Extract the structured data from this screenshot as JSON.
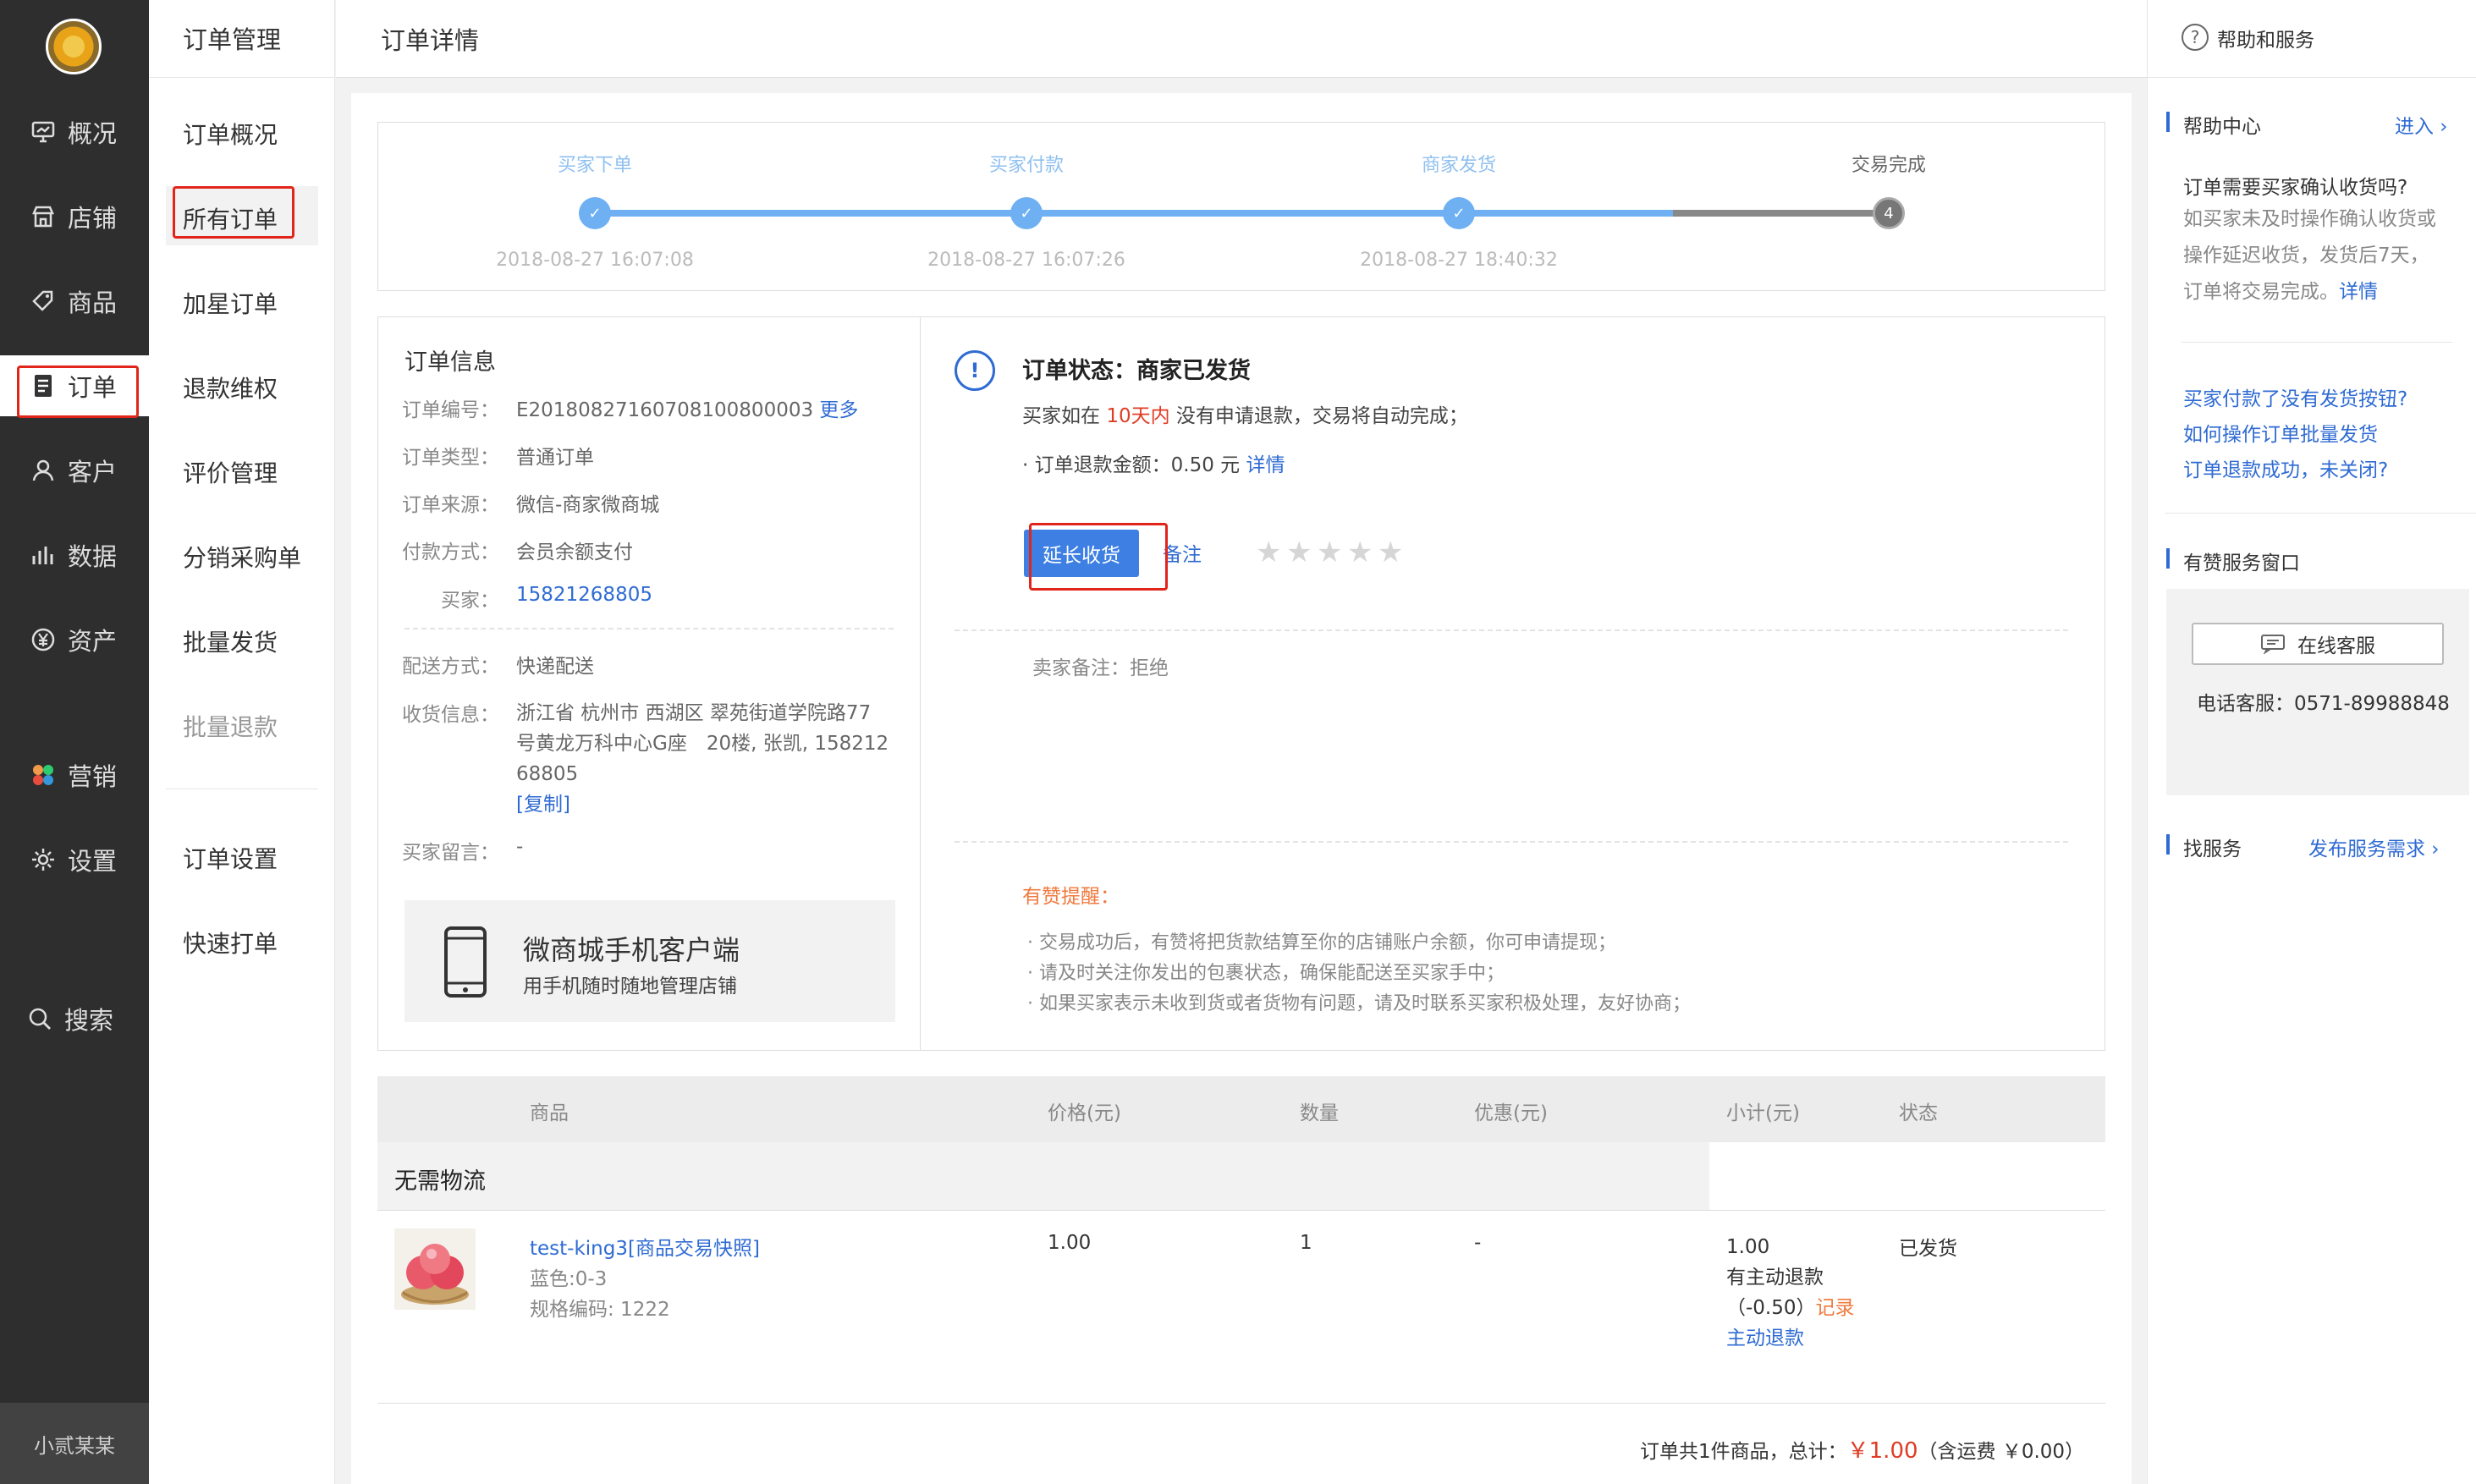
{
  "primary_nav": {
    "items": [
      {
        "label": "概况",
        "icon": "overview-icon"
      },
      {
        "label": "店铺",
        "icon": "store-icon"
      },
      {
        "label": "商品",
        "icon": "tag-icon"
      },
      {
        "label": "订单",
        "icon": "order-icon",
        "active": true
      },
      {
        "label": "客户",
        "icon": "user-icon"
      },
      {
        "label": "数据",
        "icon": "bar-chart-icon"
      },
      {
        "label": "资产",
        "icon": "yen-icon"
      },
      {
        "label": "营销",
        "icon": "apps-icon"
      },
      {
        "label": "设置",
        "icon": "gear-icon"
      },
      {
        "label": "搜索",
        "icon": "search-icon"
      }
    ],
    "username": "小贰某某"
  },
  "secondary_nav": {
    "title": "订单管理",
    "items": [
      "订单概况",
      "所有订单",
      "加星订单",
      "退款维权",
      "评价管理",
      "分销采购单",
      "批量发货",
      "批量退款",
      "订单设置",
      "快速打单"
    ],
    "active": "所有订单"
  },
  "header": {
    "title": "订单详情"
  },
  "progress": {
    "steps": [
      {
        "label": "买家下单",
        "time": "2018-08-27 16:07:08",
        "done": true
      },
      {
        "label": "买家付款",
        "time": "2018-08-27 16:07:26",
        "done": true
      },
      {
        "label": "商家发货",
        "time": "2018-08-27 18:40:32",
        "done": true
      },
      {
        "label": "交易完成",
        "time": "",
        "done": false,
        "number": "4"
      }
    ],
    "colors": {
      "done": "#6fb0f3",
      "pending": "#888888"
    }
  },
  "order_info": {
    "title": "订单信息",
    "order_no_label": "订单编号：",
    "order_no": "E20180827160708100800003",
    "more": "更多",
    "type_label": "订单类型：",
    "type": "普通订单",
    "source_label": "订单来源：",
    "source": "微信-商家微商城",
    "pay_label": "付款方式：",
    "pay": "会员余额支付",
    "buyer_label": "买家：",
    "buyer": "15821268805",
    "ship_method_label": "配送方式：",
    "ship_method": "快递配送",
    "receiver_label": "收货信息：",
    "receiver_line1": "浙江省 杭州市 西湖区 翠苑街道学院路77",
    "receiver_line2": "号黄龙万科中心G座　20楼, 张凯, 158212",
    "receiver_line3": "68805",
    "copy": "[复制]",
    "message_label": "买家留言：",
    "message": "-"
  },
  "app_promo": {
    "title": "微商城手机客户端",
    "subtitle": "用手机随时随地管理店铺"
  },
  "status": {
    "title": "订单状态：商家已发货",
    "notice_prefix": "买家如在",
    "notice_days": "10天内",
    "notice_suffix": "没有申请退款，交易将自动完成；",
    "refund_label": "· 订单退款金额：",
    "refund_amount": "0.50 元",
    "refund_detail": "详情",
    "extend_button": "延长收货",
    "remark_link": "备注",
    "star_count": 5,
    "seller_note_label": "卖家备注：",
    "seller_note": "拒绝",
    "tips_title": "有赞提醒：",
    "tips": [
      "· 交易成功后，有赞将把货款结算至你的店铺账户余额，你可申请提现；",
      "· 请及时关注你发出的包裹状态，确保能配送至买家手中；",
      "· 如果买家表示未收到货或者货物有问题，请及时联系买家积极处理，友好协商；"
    ]
  },
  "table": {
    "headers": [
      "商品",
      "价格(元)",
      "数量",
      "优惠(元)",
      "小计(元)",
      "状态"
    ],
    "group": "无需物流",
    "row": {
      "name": "test-king3[商品交易快照]",
      "sku": "蓝色:0-3",
      "code": "规格编码: 1222",
      "price": "1.00",
      "qty": "1",
      "discount": "-",
      "subtotal": "1.00",
      "refund_note": "有主动退款",
      "refund_amount": "（-0.50）",
      "refund_record": "记录",
      "refund_action": "主动退款",
      "status": "已发货"
    },
    "footer_prefix": "订单共1件商品，总计：",
    "footer_total": "￥1.00",
    "footer_suffix": "（含运费 ￥0.00）"
  },
  "help": {
    "title": "帮助和服务",
    "center_title": "帮助中心",
    "enter": "进入",
    "q_title": "订单需要买家确认收货吗?",
    "q_lines": [
      "如买家未及时操作确认收货或",
      "操作延迟收货，发货后7天，",
      "订单将交易完成。"
    ],
    "q_detail": "详情",
    "links": [
      "买家付款了没有发货按钮?",
      "如何操作订单批量发货",
      "订单退款成功，未关闭?"
    ],
    "window_title": "有赞服务窗口",
    "online_button": "在线客服",
    "phone": "电话客服：0571-89988848",
    "find_title": "找服务",
    "publish": "发布服务需求"
  }
}
